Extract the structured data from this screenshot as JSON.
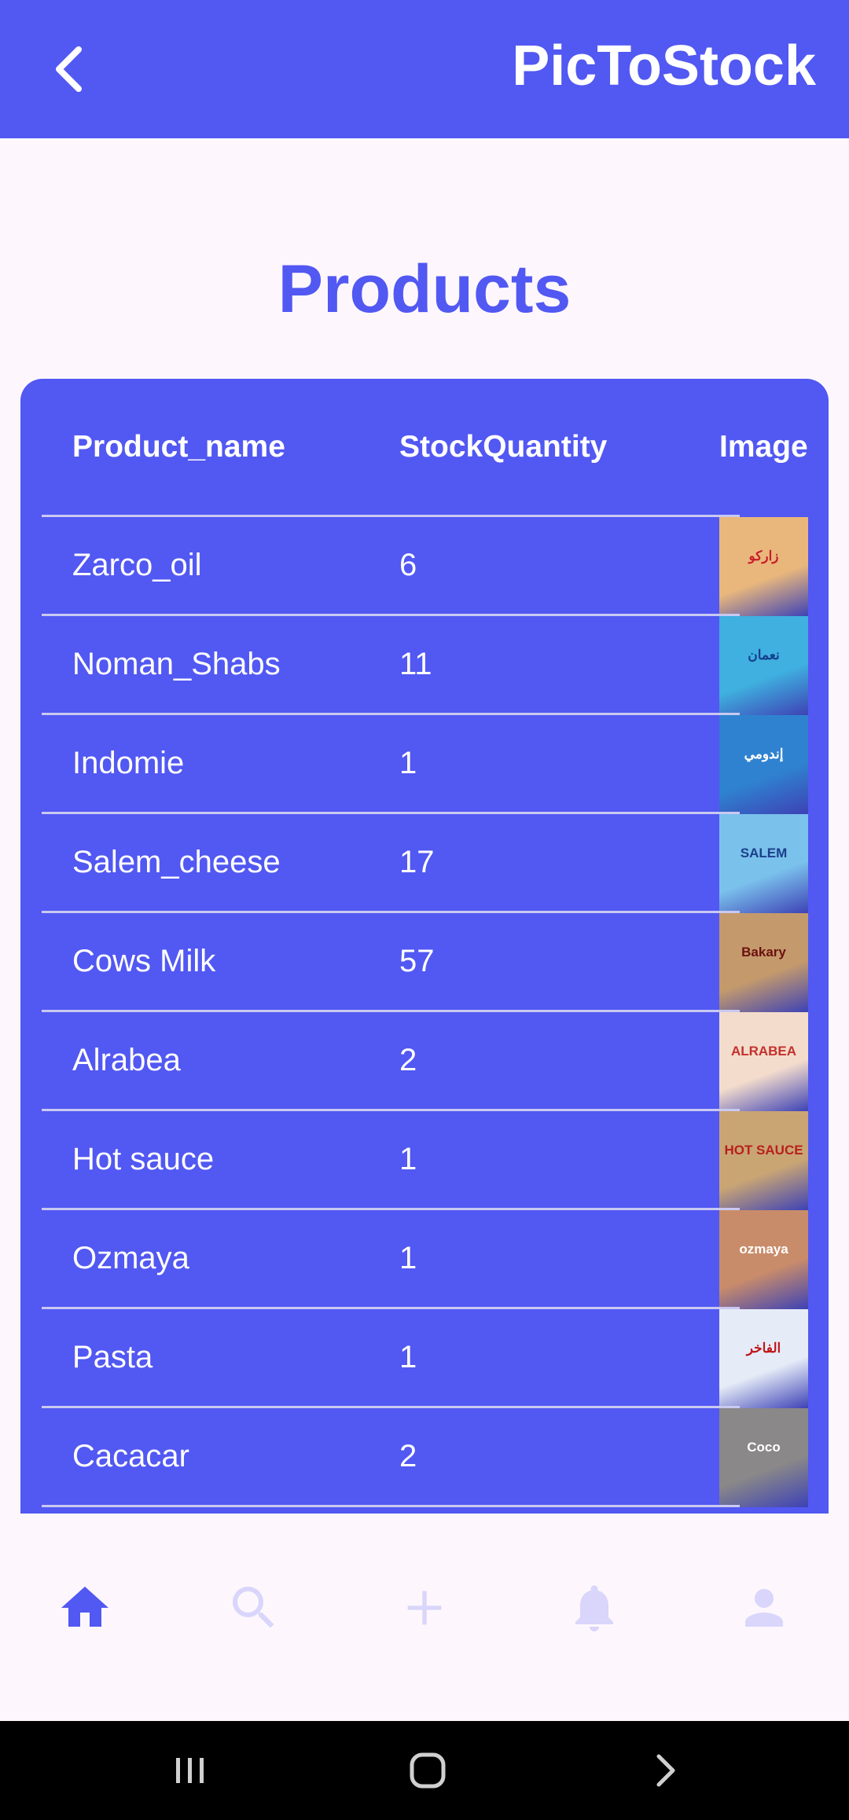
{
  "appbar": {
    "title": "PicToStock",
    "back_icon": "chevron-left-icon",
    "background": "#5258f2"
  },
  "page": {
    "title": "Products"
  },
  "table": {
    "columns": [
      "Product_name",
      "StockQuantity",
      "Image"
    ],
    "rows": [
      {
        "name": "Zarco_oil",
        "qty": "6",
        "thumb_text": "زاركو",
        "thumb_bg": "#e9b77c",
        "thumb_fg": "#c81e2a"
      },
      {
        "name": "Noman_Shabs",
        "qty": "11",
        "thumb_text": "نعمان",
        "thumb_bg": "#3fb0df",
        "thumb_fg": "#16408e"
      },
      {
        "name": "Indomie",
        "qty": "1",
        "thumb_text": "إندومي",
        "thumb_bg": "#2f82d0",
        "thumb_fg": "#ffffff"
      },
      {
        "name": "Salem_cheese",
        "qty": "17",
        "thumb_text": "SALEM",
        "thumb_bg": "#7ac1ec",
        "thumb_fg": "#1b3f8a"
      },
      {
        "name": "Cows Milk",
        "qty": "57",
        "thumb_text": "Bakary",
        "thumb_bg": "#c49a6c",
        "thumb_fg": "#6b1010"
      },
      {
        "name": "Alrabea",
        "qty": "2",
        "thumb_text": "ALRABEA",
        "thumb_bg": "#f3dccc",
        "thumb_fg": "#c4302c"
      },
      {
        "name": "Hot sauce",
        "qty": "1",
        "thumb_text": "HOT SAUCE",
        "thumb_bg": "#c9a574",
        "thumb_fg": "#b8201c"
      },
      {
        "name": "Ozmaya",
        "qty": "1",
        "thumb_text": "ozmaya",
        "thumb_bg": "#c98c6a",
        "thumb_fg": "#ffffff"
      },
      {
        "name": "Pasta",
        "qty": "1",
        "thumb_text": "الفاخر",
        "thumb_bg": "#e5ecf7",
        "thumb_fg": "#c0161b"
      },
      {
        "name": "Cacacar",
        "qty": "2",
        "thumb_text": "Coco",
        "thumb_bg": "#8a8888",
        "thumb_fg": "#ffffff"
      }
    ]
  },
  "bottom_nav": {
    "items": [
      {
        "icon": "home-icon",
        "active": true
      },
      {
        "icon": "search-icon",
        "active": false
      },
      {
        "icon": "add-icon",
        "active": false
      },
      {
        "icon": "bell-icon",
        "active": false
      },
      {
        "icon": "profile-icon",
        "active": false
      }
    ],
    "active_color": "#5258f2",
    "inactive_color": "#d9d5fb"
  },
  "system_nav": {
    "buttons": [
      "recents-icon",
      "home-circle-icon",
      "forward-chevron-icon"
    ]
  }
}
